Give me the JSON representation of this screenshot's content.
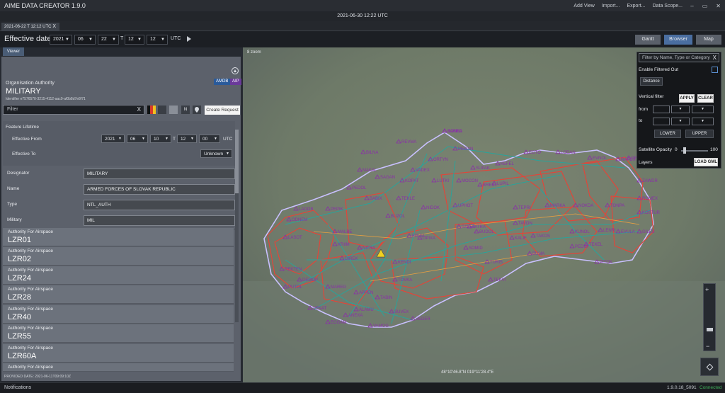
{
  "app": {
    "title": "AIME DATA CREATOR 1.9.0"
  },
  "menu": {
    "items": [
      "Add View",
      "Import...",
      "Export...",
      "Data Scope..."
    ]
  },
  "current_datetime": "2021-06-30 12:22 UTC",
  "doc_tab": {
    "label": "2021-06-22 T 12:12 UTC",
    "close": "X"
  },
  "effective": {
    "label": "Effective date",
    "year": "2021",
    "month": "06",
    "day": "22",
    "t": "T",
    "hour": "12",
    "minute": "12",
    "tz": "UTC"
  },
  "views": {
    "gantt": "Gantt",
    "browser": "Browser",
    "map": "Map"
  },
  "panel": {
    "tab": "Viewer",
    "org_type": "Organisation Authority",
    "org_name": "MILITARY",
    "identifier": "Identifier  e7576570-3215-4112-aac0-af0b8d7e8f71",
    "badge_amdb": "AMDB",
    "badge_aip": "AIP",
    "filter_placeholder": "Filter",
    "filter_clear": "X",
    "n_tool": "N",
    "create_request": "Create Request"
  },
  "lifetime": {
    "title": "Feature Lifetime",
    "from_label": "Effective From",
    "from_year": "2021",
    "from_month": "06",
    "from_day": "10",
    "t": "T",
    "from_hour": "12",
    "from_minute": "00",
    "tz": "UTC",
    "to_label": "Effective To",
    "to_value": "Unknown"
  },
  "fields": [
    {
      "key": "Designator",
      "value": "MILITARY"
    },
    {
      "key": "Name",
      "value": "ARMED FORCES OF SLOVAK REPUBLIC"
    },
    {
      "key": "Type",
      "value": "NTL_AUTH"
    },
    {
      "key": "Military",
      "value": "MIL"
    }
  ],
  "authorities": [
    {
      "label": "Authority For Airspace",
      "name": "LZR01"
    },
    {
      "label": "Authority For Airspace",
      "name": "LZR02"
    },
    {
      "label": "Authority For Airspace",
      "name": "LZR24"
    },
    {
      "label": "Authority For Airspace",
      "name": "LZR28"
    },
    {
      "label": "Authority For Airspace",
      "name": "LZR40"
    },
    {
      "label": "Authority For Airspace",
      "name": "LZR55"
    },
    {
      "label": "Authority For Airspace",
      "name": "LZR60A"
    },
    {
      "label": "Authority For Airspace",
      "name": ""
    }
  ],
  "provided_date": "PROVIDED DATE: 2021-06-11T09:09:10Z",
  "map": {
    "zoom_label": "8 zoom",
    "coords": "48°10'46.8\"N 019°11'28.4\"E",
    "waypoints": [
      "BABKO",
      "REVMA",
      "BILNA",
      "MEBAN",
      "ORTYN",
      "MAKAL",
      "VADEX",
      "SUPAK",
      "KEFEL",
      "EGTO",
      "LODAN",
      "EVNOL",
      "RAFOX",
      "PEKIR",
      "SAGAN",
      "KOPAT",
      "LUTKI",
      "MOCON",
      "BREST",
      "LUPIL",
      "ZAWDR",
      "PEDOL",
      "BABIX",
      "TEKLE",
      "NIDOK",
      "UPHOT",
      "BUZOL",
      "ROMEX",
      "LADOB",
      "ODNEM",
      "PEPIK",
      "SALES",
      "FATRA",
      "TEPRI",
      "MARKA",
      "NOKDA",
      "TONPA",
      "KOSTUR",
      "MALBE",
      "ERVIA",
      "UPIXA",
      "BUDOL",
      "TAVON",
      "KUNOL",
      "LENRI",
      "EVULA",
      "GILES",
      "LASOT",
      "KRIIM",
      "NITRA",
      "SOMID",
      "KALIF",
      "TAKOS",
      "PEDIS",
      "TEKEL",
      "DIREK",
      "BUMA",
      "KENDI",
      "TURIS",
      "PITOK",
      "REKTEN",
      "TOVKA",
      "TEKVI",
      "DEMOP",
      "APPEN",
      "TABIN",
      "PUTOL",
      "MAREG",
      "VEKAT",
      "SUVEX",
      "ANEXA",
      "VEDER",
      "EGGAM",
      "VAMOG",
      "ALAMU",
      "KONBA"
    ],
    "filter_placeholder": "Filter by Name, Type or Category",
    "filter_clear": "X",
    "enable_filtered_out": "Enable Filtered Out",
    "distance": "Distance",
    "vertical_filter": "Vertical filter",
    "apply": "APPLY",
    "clear": "CLEAR",
    "from": "from",
    "to": "to",
    "lower": "LOWER",
    "upper": "UPPER",
    "satellite_opacity": "Satellite Opacity",
    "opacity_min": "0",
    "opacity_max": "100",
    "layers": "Layers",
    "load_gml": "LOAD GML",
    "zoom_plus": "+",
    "zoom_minus": "−"
  },
  "status": {
    "notifications": "Notifications",
    "version": "1.9.0.18_5091",
    "connected": "Connected"
  },
  "colors": {
    "accent": "#4a6ea0",
    "airspace": "#e0463a",
    "route": "#2aa39a",
    "label": "#8a2fa8",
    "border": "#c9c0ff",
    "badge_aip": "#6a3a9a",
    "badge_amdb": "#2a5a9a"
  }
}
